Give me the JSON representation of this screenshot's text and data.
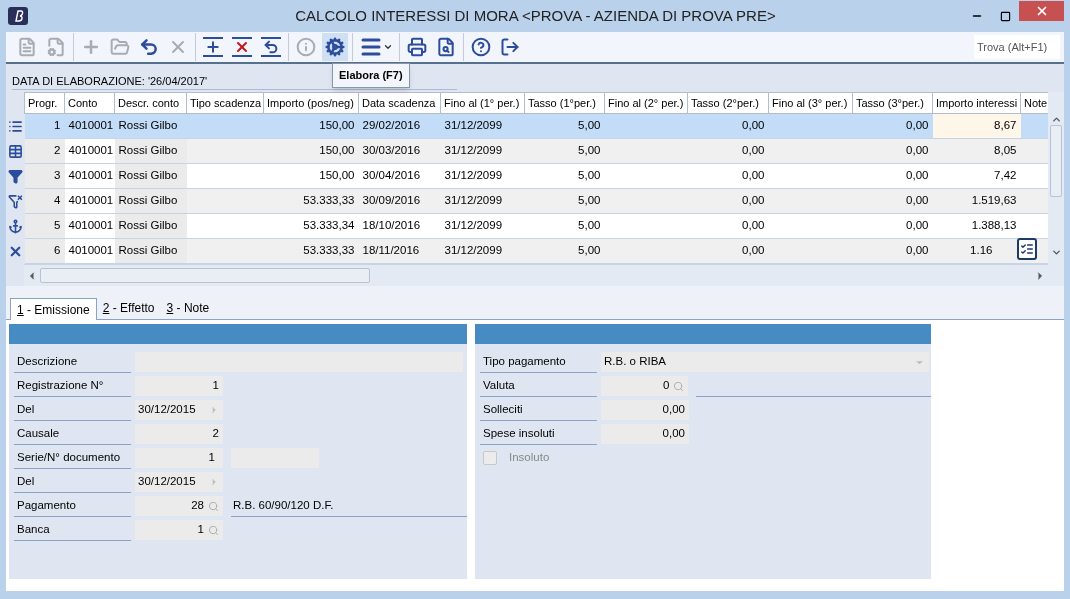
{
  "window": {
    "title": "CALCOLO INTERESSI DI MORA <PROVA - AZIENDA DI PROVA PRE>"
  },
  "toolbar": {
    "groups": [
      [
        {
          "kind": "new-doc",
          "disabled": true,
          "highlighted": false
        },
        {
          "kind": "doc-settings",
          "disabled": true,
          "highlighted": false
        }
      ],
      [
        {
          "kind": "add",
          "disabled": true,
          "highlighted": false
        },
        {
          "kind": "open",
          "disabled": true,
          "highlighted": false
        },
        {
          "kind": "undo",
          "disabled": false,
          "highlighted": false
        },
        {
          "kind": "cancel",
          "disabled": true,
          "highlighted": false
        }
      ],
      [
        {
          "kind": "insert-row",
          "disabled": false,
          "highlighted": false
        },
        {
          "kind": "delete-row",
          "disabled": false,
          "highlighted": false
        },
        {
          "kind": "revert-row",
          "disabled": false,
          "highlighted": false
        }
      ],
      [
        {
          "kind": "info",
          "disabled": true,
          "highlighted": false
        },
        {
          "kind": "process",
          "disabled": false,
          "highlighted": true
        }
      ],
      [
        {
          "kind": "menu",
          "disabled": false,
          "highlighted": false
        }
      ],
      [
        {
          "kind": "print",
          "disabled": false,
          "highlighted": false
        },
        {
          "kind": "preview",
          "disabled": false,
          "highlighted": false
        }
      ],
      [
        {
          "kind": "help",
          "disabled": false,
          "highlighted": false
        },
        {
          "kind": "exit",
          "disabled": false,
          "highlighted": false
        }
      ]
    ],
    "tooltip": "Elabora (F7)",
    "search": {
      "placeholder": "Trova (Alt+F1)"
    }
  },
  "info_bar": "DATA DI ELABORAZIONE: '26/04/2017'",
  "side_actions": [
    {
      "kind": "list"
    },
    {
      "kind": "table"
    },
    {
      "kind": "filter-apply"
    },
    {
      "kind": "filter-remove"
    },
    {
      "kind": "anchor"
    },
    {
      "kind": "clear"
    }
  ],
  "table": {
    "columns": [
      {
        "label": "Progr."
      },
      {
        "label": "Conto"
      },
      {
        "label": "Descr. conto"
      },
      {
        "label": "Tipo scadenza"
      },
      {
        "label": "Importo (pos/neg)"
      },
      {
        "label": "Data scadenza"
      },
      {
        "label": "Fino al (1° per.)"
      },
      {
        "label": "Tasso (1°per.)"
      },
      {
        "label": "Fino al (2° per.)"
      },
      {
        "label": "Tasso (2°per.)"
      },
      {
        "label": "Fino al (3° per.)"
      },
      {
        "label": "Tasso (3°per.)"
      },
      {
        "label": "Importo interessi"
      },
      {
        "label": "Note"
      }
    ],
    "rows": [
      {
        "selected": true,
        "cells": [
          "1",
          "4010001",
          "Rossi Gilbo",
          "",
          "150,00",
          "29/02/2016",
          "31/12/2099",
          "5,00",
          "",
          "0,00",
          "",
          "0,00",
          "8,67",
          ""
        ]
      },
      {
        "selected": false,
        "cells": [
          "2",
          "4010001",
          "Rossi Gilbo",
          "",
          "150,00",
          "30/03/2016",
          "31/12/2099",
          "5,00",
          "",
          "0,00",
          "",
          "0,00",
          "8,05",
          ""
        ]
      },
      {
        "selected": false,
        "cells": [
          "3",
          "4010001",
          "Rossi Gilbo",
          "",
          "150,00",
          "30/04/2016",
          "31/12/2099",
          "5,00",
          "",
          "0,00",
          "",
          "0,00",
          "7,42",
          ""
        ]
      },
      {
        "selected": false,
        "cells": [
          "4",
          "4010001",
          "Rossi Gilbo",
          "",
          "53.333,33",
          "30/09/2016",
          "31/12/2099",
          "5,00",
          "",
          "0,00",
          "",
          "0,00",
          "1.519,63",
          ""
        ]
      },
      {
        "selected": false,
        "cells": [
          "5",
          "4010001",
          "Rossi Gilbo",
          "",
          "53.333,34",
          "18/10/2016",
          "31/12/2099",
          "5,00",
          "",
          "0,00",
          "",
          "0,00",
          "1.388,13",
          ""
        ]
      },
      {
        "selected": false,
        "cells": [
          "6",
          "4010001",
          "Rossi Gilbo",
          "",
          "53.333,33",
          "18/11/2016",
          "31/12/2099",
          "5,00",
          "",
          "0,00",
          "",
          "0,00",
          "1.16",
          ""
        ]
      }
    ]
  },
  "tabs": [
    {
      "label": "1 - Emissione",
      "selected": true
    },
    {
      "label": "2 - Effetto",
      "selected": false
    },
    {
      "label": "3 - Note",
      "selected": false
    }
  ],
  "left_panel": [
    {
      "kind": "wide",
      "label": "Descrizione"
    },
    {
      "kind": "number",
      "label": "Registrazione N°",
      "value": "1"
    },
    {
      "kind": "date",
      "label": "Del",
      "value": "30/12/2015"
    },
    {
      "kind": "number",
      "label": "Causale",
      "value": "2"
    },
    {
      "kind": "number-extra",
      "label": "Serie/N° documento",
      "value": "1"
    },
    {
      "kind": "date",
      "label": "Del",
      "value": "30/12/2015"
    },
    {
      "kind": "lookup",
      "label": "Pagamento",
      "value": "28",
      "description": "R.B. 60/90/120 D.F."
    },
    {
      "kind": "lookup",
      "label": "Banca",
      "value": "1"
    }
  ],
  "right_panel": [
    {
      "kind": "select",
      "label": "Tipo pagamento",
      "value": "R.B. o RIBA"
    },
    {
      "kind": "lookup-line",
      "label": "Valuta",
      "value": "0"
    },
    {
      "kind": "number",
      "label": "Solleciti",
      "value": "0,00"
    },
    {
      "kind": "number",
      "label": "Spese insoluti",
      "value": "0,00"
    },
    {
      "kind": "checkbox",
      "label": "Insoluto",
      "checked": false,
      "disabled": true
    }
  ]
}
